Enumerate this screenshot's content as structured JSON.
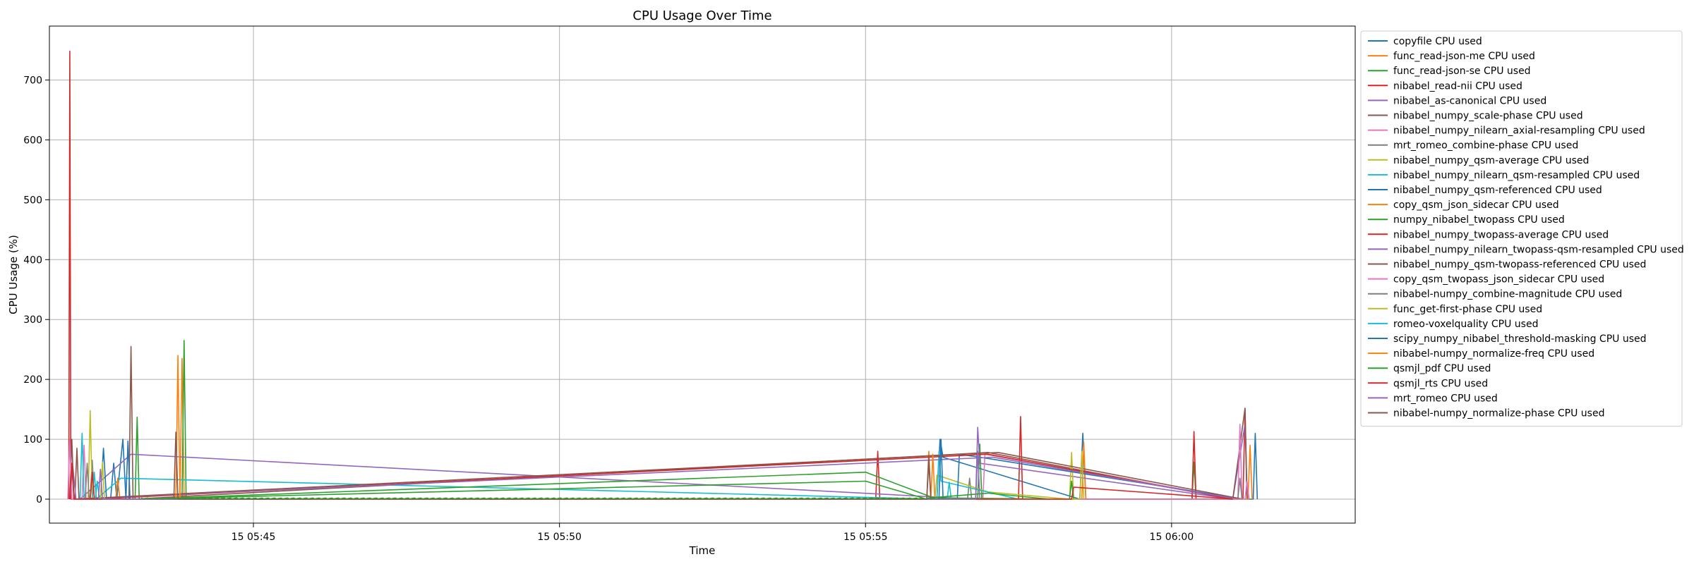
{
  "chart_data": {
    "type": "line",
    "title": "CPU Usage Over Time",
    "xlabel": "Time",
    "ylabel": "CPU Usage (%)",
    "x_range": [
      "2024-01-15T05:41:40",
      "2024-01-15T06:03:00"
    ],
    "ylim": [
      -40,
      790
    ],
    "x_ticks": [
      {
        "t": "2024-01-15T05:45:00",
        "label": "15 05:45"
      },
      {
        "t": "2024-01-15T05:50:00",
        "label": "15 05:50"
      },
      {
        "t": "2024-01-15T05:55:00",
        "label": "15 05:55"
      },
      {
        "t": "2024-01-15T06:00:00",
        "label": "15 06:00"
      }
    ],
    "y_ticks": [
      0,
      100,
      200,
      300,
      400,
      500,
      600,
      700
    ],
    "grid": true,
    "legend_position": "outside-top-right",
    "series": [
      {
        "name": "copyfile CPU used",
        "color": "#1f77b4",
        "points": [
          [
            "05:42:40",
            0
          ],
          [
            "05:42:43",
            60
          ],
          [
            "05:42:46",
            0
          ],
          [
            "05:42:52",
            100
          ],
          [
            "05:42:55",
            0
          ],
          [
            "05:56:10",
            0
          ],
          [
            "05:56:13",
            100
          ],
          [
            "05:56:16",
            70
          ],
          [
            "05:58:30",
            0
          ],
          [
            "05:58:33",
            110
          ],
          [
            "05:58:36",
            0
          ],
          [
            "06:01:20",
            0
          ],
          [
            "06:01:22",
            110
          ],
          [
            "06:01:24",
            0
          ]
        ]
      },
      {
        "name": "func_read-json-me CPU used",
        "color": "#ff7f0e",
        "points": [
          [
            "05:43:48",
            0
          ],
          [
            "05:43:50",
            235
          ],
          [
            "05:43:52",
            0
          ],
          [
            "05:56:00",
            0
          ],
          [
            "05:56:02",
            80
          ],
          [
            "05:56:04",
            0
          ],
          [
            "05:58:32",
            0
          ],
          [
            "05:58:34",
            95
          ],
          [
            "05:58:36",
            0
          ]
        ]
      },
      {
        "name": "func_read-json-se CPU used",
        "color": "#2ca02c",
        "points": [
          [
            "05:43:04",
            0
          ],
          [
            "05:43:06",
            137
          ],
          [
            "05:43:08",
            0
          ],
          [
            "05:43:50",
            0
          ],
          [
            "05:43:52",
            265
          ],
          [
            "05:43:54",
            0
          ],
          [
            "05:56:50",
            0
          ],
          [
            "05:56:52",
            92
          ],
          [
            "05:56:54",
            0
          ],
          [
            "06:00:20",
            0
          ],
          [
            "06:00:22",
            62
          ],
          [
            "06:00:24",
            0
          ]
        ]
      },
      {
        "name": "nibabel_read-nii CPU used",
        "color": "#d62728",
        "points": [
          [
            "05:41:59",
            0
          ],
          [
            "05:42:00",
            748
          ],
          [
            "05:42:01",
            0
          ],
          [
            "05:55:10",
            0
          ],
          [
            "05:55:12",
            80
          ],
          [
            "05:55:14",
            0
          ],
          [
            "05:57:30",
            0
          ],
          [
            "05:57:32",
            138
          ],
          [
            "05:57:34",
            0
          ],
          [
            "06:00:20",
            0
          ],
          [
            "06:00:22",
            113
          ],
          [
            "06:00:24",
            0
          ],
          [
            "06:01:10",
            0
          ],
          [
            "06:01:12",
            150
          ],
          [
            "06:01:14",
            0
          ]
        ]
      },
      {
        "name": "nibabel_as-canonical CPU used",
        "color": "#9467bd",
        "points": [
          [
            "05:42:10",
            0
          ],
          [
            "05:43:00",
            75
          ],
          [
            "05:56:48",
            0
          ],
          [
            "05:56:50",
            120
          ],
          [
            "05:56:52",
            60
          ],
          [
            "06:01:00",
            0
          ],
          [
            "06:01:12",
            125
          ],
          [
            "06:01:14",
            0
          ]
        ]
      },
      {
        "name": "nibabel_numpy_scale-phase CPU used",
        "color": "#8c564b",
        "points": [
          [
            "05:42:05",
            0
          ],
          [
            "05:42:07",
            85
          ],
          [
            "05:42:09",
            0
          ],
          [
            "05:42:58",
            0
          ],
          [
            "05:43:00",
            255
          ],
          [
            "05:43:02",
            0
          ],
          [
            "05:57:00",
            78
          ],
          [
            "06:01:00",
            0
          ],
          [
            "06:01:12",
            152
          ],
          [
            "06:01:14",
            0
          ]
        ]
      },
      {
        "name": "nibabel_numpy_nilearn_axial-resampling CPU used",
        "color": "#e377c2",
        "points": [
          [
            "05:42:12",
            0
          ],
          [
            "05:42:14",
            90
          ],
          [
            "05:42:16",
            0
          ],
          [
            "05:56:55",
            0
          ],
          [
            "05:56:57",
            75
          ],
          [
            "06:01:05",
            0
          ],
          [
            "06:01:07",
            125
          ],
          [
            "06:01:09",
            0
          ]
        ]
      },
      {
        "name": "mrt_romeo_combine-phase CPU used",
        "color": "#7f7f7f",
        "points": [
          [
            "05:42:20",
            0
          ],
          [
            "05:42:22",
            65
          ],
          [
            "05:42:24",
            0
          ],
          [
            "05:56:40",
            0
          ],
          [
            "05:56:42",
            35
          ],
          [
            "05:56:44",
            0
          ],
          [
            "06:01:05",
            0
          ],
          [
            "06:01:07",
            35
          ],
          [
            "06:01:09",
            0
          ]
        ]
      },
      {
        "name": "nibabel_numpy_qsm-average CPU used",
        "color": "#bcbd22",
        "points": [
          [
            "05:42:18",
            0
          ],
          [
            "05:42:20",
            148
          ],
          [
            "05:42:22",
            0
          ],
          [
            "05:56:08",
            0
          ],
          [
            "05:56:10",
            40
          ],
          [
            "05:57:00",
            12
          ],
          [
            "05:58:20",
            0
          ],
          [
            "05:58:22",
            78
          ],
          [
            "05:58:24",
            0
          ]
        ]
      },
      {
        "name": "nibabel_numpy_nilearn_qsm-resampled CPU used",
        "color": "#17becf",
        "points": [
          [
            "05:42:10",
            0
          ],
          [
            "05:42:12",
            110
          ],
          [
            "05:42:14",
            0
          ],
          [
            "05:42:22",
            0
          ],
          [
            "05:42:24",
            45
          ],
          [
            "05:42:26",
            0
          ],
          [
            "05:42:50",
            35
          ],
          [
            "05:56:10",
            0
          ],
          [
            "05:56:12",
            80
          ],
          [
            "05:56:14",
            30
          ],
          [
            "05:57:30",
            0
          ]
        ]
      },
      {
        "name": "nibabel_numpy_qsm-referenced CPU used",
        "color": "#1f77b4",
        "points": [
          [
            "05:42:30",
            0
          ],
          [
            "05:42:33",
            85
          ],
          [
            "05:42:36",
            0
          ],
          [
            "05:56:30",
            0
          ],
          [
            "05:56:32",
            75
          ],
          [
            "05:57:00",
            68
          ],
          [
            "06:01:10",
            0
          ]
        ]
      },
      {
        "name": "copy_qsm_json_sidecar CPU used",
        "color": "#ff7f0e",
        "points": [
          [
            "05:42:45",
            0
          ],
          [
            "05:42:47",
            35
          ],
          [
            "05:42:49",
            0
          ],
          [
            "06:01:15",
            0
          ],
          [
            "06:01:17",
            90
          ],
          [
            "06:01:19",
            0
          ]
        ]
      },
      {
        "name": "numpy_nibabel_twopass CPU used",
        "color": "#2ca02c",
        "points": [
          [
            "05:43:10",
            0
          ],
          [
            "05:55:00",
            45
          ],
          [
            "05:56:10",
            0
          ],
          [
            "05:56:12",
            2
          ],
          [
            "05:58:20",
            0
          ],
          [
            "05:58:22",
            30
          ],
          [
            "05:58:24",
            0
          ]
        ]
      },
      {
        "name": "nibabel_numpy_twopass-average CPU used",
        "color": "#d62728",
        "points": [
          [
            "05:42:20",
            0
          ],
          [
            "05:42:22",
            45
          ],
          [
            "05:42:24",
            0
          ],
          [
            "05:57:00",
            75
          ],
          [
            "06:01:00",
            0
          ]
        ]
      },
      {
        "name": "nibabel_numpy_nilearn_twopass-qsm-resampled CPU used",
        "color": "#9467bd",
        "points": [
          [
            "05:42:00",
            0
          ],
          [
            "05:42:03",
            55
          ],
          [
            "05:42:06",
            0
          ],
          [
            "05:57:05",
            70
          ],
          [
            "06:01:05",
            0
          ]
        ]
      },
      {
        "name": "nibabel_numpy_qsm-twopass-referenced CPU used",
        "color": "#8c564b",
        "points": [
          [
            "05:42:00",
            0
          ],
          [
            "05:42:02",
            100
          ],
          [
            "05:42:04",
            0
          ],
          [
            "05:57:10",
            78
          ],
          [
            "06:01:10",
            0
          ]
        ]
      },
      {
        "name": "copy_qsm_twopass_json_sidecar CPU used",
        "color": "#e377c2",
        "points": [
          [
            "05:41:58",
            0
          ],
          [
            "05:42:00",
            98
          ],
          [
            "05:42:02",
            0
          ],
          [
            "06:01:12",
            0
          ],
          [
            "06:01:14",
            30
          ],
          [
            "06:01:16",
            0
          ]
        ]
      },
      {
        "name": "nibabel-numpy_combine-magnitude CPU used",
        "color": "#7f7f7f",
        "points": [
          [
            "05:42:15",
            0
          ],
          [
            "05:42:17",
            60
          ],
          [
            "05:42:19",
            0
          ],
          [
            "05:56:00",
            0
          ],
          [
            "05:56:02",
            60
          ],
          [
            "05:56:04",
            0
          ]
        ]
      },
      {
        "name": "func_get-first-phase CPU used",
        "color": "#bcbd22",
        "points": [
          [
            "05:42:30",
            0
          ],
          [
            "05:42:32",
            62
          ],
          [
            "05:42:34",
            0
          ],
          [
            "05:58:30",
            0
          ],
          [
            "05:58:32",
            80
          ],
          [
            "05:58:34",
            0
          ]
        ]
      },
      {
        "name": "romeo-voxelquality CPU used",
        "color": "#17becf",
        "points": [
          [
            "05:42:25",
            0
          ],
          [
            "05:42:27",
            30
          ],
          [
            "05:42:29",
            0
          ],
          [
            "05:56:20",
            0
          ],
          [
            "05:56:22",
            28
          ],
          [
            "05:56:24",
            0
          ]
        ]
      },
      {
        "name": "scipy_numpy_nibabel_threshold-masking CPU used",
        "color": "#1f77b4",
        "points": [
          [
            "05:42:55",
            0
          ],
          [
            "05:42:57",
            97
          ],
          [
            "05:42:59",
            0
          ],
          [
            "05:56:12",
            0
          ],
          [
            "05:56:14",
            100
          ],
          [
            "05:56:16",
            0
          ]
        ]
      },
      {
        "name": "nibabel-numpy_normalize-freq CPU used",
        "color": "#ff7f0e",
        "points": [
          [
            "05:43:44",
            0
          ],
          [
            "05:43:46",
            240
          ],
          [
            "05:43:48",
            0
          ],
          [
            "05:56:04",
            0
          ],
          [
            "05:56:06",
            75
          ],
          [
            "05:56:08",
            0
          ]
        ]
      },
      {
        "name": "qsmjl_pdf CPU used",
        "color": "#2ca02c",
        "points": [
          [
            "05:43:10",
            0
          ],
          [
            "05:55:00",
            30
          ],
          [
            "05:56:00",
            0
          ],
          [
            "05:56:02",
            2
          ],
          [
            "05:57:00",
            10
          ],
          [
            "05:58:00",
            0
          ]
        ]
      },
      {
        "name": "qsmjl_rts CPU used",
        "color": "#d62728",
        "points": [
          [
            "05:42:00",
            0
          ],
          [
            "05:42:02",
            60
          ],
          [
            "05:42:04",
            0
          ],
          [
            "05:58:22",
            0
          ],
          [
            "05:58:24",
            20
          ],
          [
            "06:00:00",
            8
          ],
          [
            "06:01:00",
            0
          ]
        ]
      },
      {
        "name": "mrt_romeo CPU used",
        "color": "#9467bd",
        "points": [
          [
            "05:42:28",
            0
          ],
          [
            "05:42:30",
            50
          ],
          [
            "05:42:32",
            0
          ],
          [
            "05:56:48",
            0
          ],
          [
            "05:56:50",
            80
          ],
          [
            "05:56:52",
            0
          ]
        ]
      },
      {
        "name": "nibabel-numpy_normalize-phase CPU used",
        "color": "#8c564b",
        "points": [
          [
            "05:43:42",
            0
          ],
          [
            "05:43:44",
            112
          ],
          [
            "05:43:46",
            0
          ],
          [
            "05:56:00",
            0
          ],
          [
            "05:56:02",
            70
          ],
          [
            "05:56:04",
            0
          ]
        ]
      }
    ]
  }
}
